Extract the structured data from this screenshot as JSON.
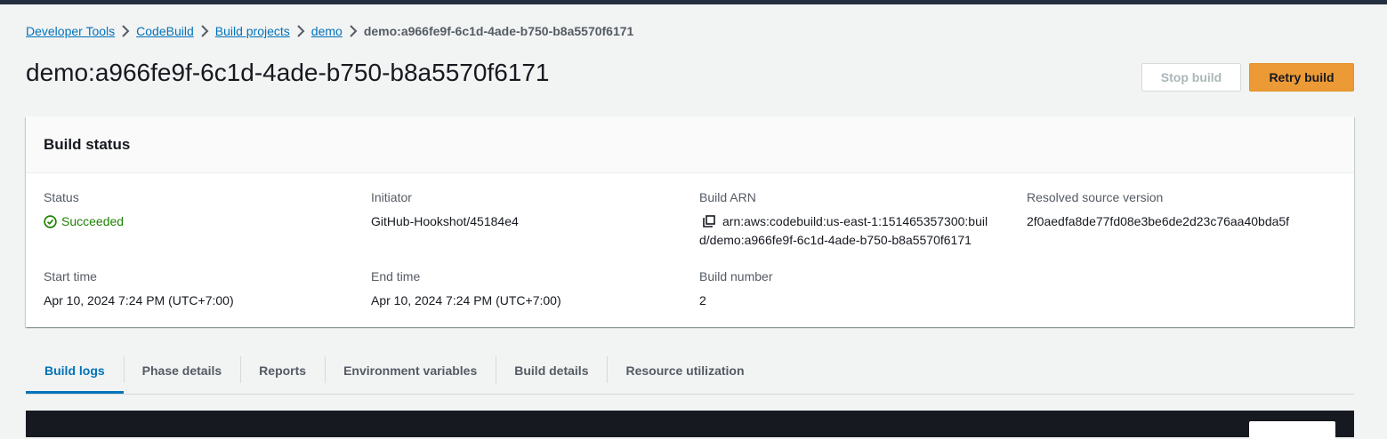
{
  "breadcrumb": {
    "items": [
      "Developer Tools",
      "CodeBuild",
      "Build projects",
      "demo"
    ],
    "current": "demo:a966fe9f-6c1d-4ade-b750-b8a5570f6171"
  },
  "page": {
    "title": "demo:a966fe9f-6c1d-4ade-b750-b8a5570f6171"
  },
  "actions": {
    "stop_label": "Stop build",
    "retry_label": "Retry build"
  },
  "build_status": {
    "title": "Build status",
    "status": {
      "label": "Status",
      "value": "Succeeded"
    },
    "initiator": {
      "label": "Initiator",
      "value": "GitHub-Hookshot/45184e4"
    },
    "arn": {
      "label": "Build ARN",
      "value_line1": "arn:aws:codebuild:us-east-1:151465357300:buil",
      "value_line2": "d/demo:a966fe9f-6c1d-4ade-b750-b8a5570f6171"
    },
    "source_version": {
      "label": "Resolved source version",
      "value": "2f0aedfa8de77fd08e3be6de2d23c76aa40bda5f"
    },
    "start_time": {
      "label": "Start time",
      "value": "Apr 10, 2024 7:24 PM (UTC+7:00)"
    },
    "end_time": {
      "label": "End time",
      "value": "Apr 10, 2024 7:24 PM (UTC+7:00)"
    },
    "build_number": {
      "label": "Build number",
      "value": "2"
    }
  },
  "tabs": [
    {
      "label": "Build logs",
      "active": true
    },
    {
      "label": "Phase details",
      "active": false
    },
    {
      "label": "Reports",
      "active": false
    },
    {
      "label": "Environment variables",
      "active": false
    },
    {
      "label": "Build details",
      "active": false
    },
    {
      "label": "Resource utilization",
      "active": false
    }
  ],
  "icons": {
    "chevron": "chevron-right-icon",
    "status": "check-circle-icon",
    "copy": "copy-icon"
  },
  "colors": {
    "link": "#0073bb",
    "success": "#1d8102",
    "primary_button": "#ec9a36",
    "header_bar": "#232f3e"
  }
}
